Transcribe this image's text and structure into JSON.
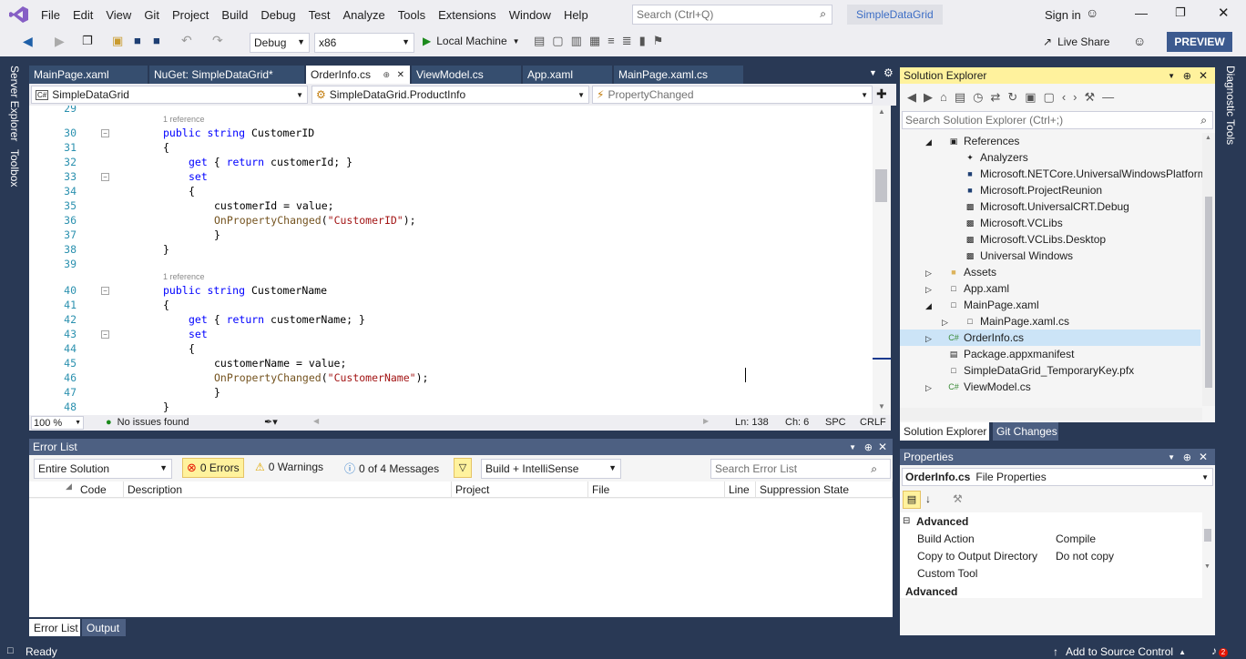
{
  "menu": {
    "items": [
      "File",
      "Edit",
      "View",
      "Git",
      "Project",
      "Build",
      "Debug",
      "Test",
      "Analyze",
      "Tools",
      "Extensions",
      "Window",
      "Help"
    ],
    "search_placeholder": "Search (Ctrl+Q)",
    "solution_name": "SimpleDataGrid",
    "sign_in": "Sign in"
  },
  "toolbar": {
    "config": "Debug",
    "platform": "x86",
    "run_label": "Local Machine",
    "live_share": "Live Share",
    "preview": "PREVIEW"
  },
  "side": {
    "left_tabs": [
      "Server Explorer",
      "Toolbox"
    ],
    "right_tabs": [
      "Diagnostic Tools"
    ]
  },
  "doc_tabs": [
    "MainPage.xaml",
    "NuGet: SimpleDataGrid*",
    "OrderInfo.cs",
    "ViewModel.cs",
    "App.xaml",
    "MainPage.xaml.cs"
  ],
  "nav": {
    "project": "SimpleDataGrid",
    "type": "SimpleDataGrid.ProductInfo",
    "member": "PropertyChanged"
  },
  "editor": {
    "lines": [
      "29",
      "30",
      "31",
      "32",
      "33",
      "34",
      "35",
      "36",
      "37",
      "38",
      "39",
      "40",
      "41",
      "42",
      "43",
      "44",
      "45",
      "46",
      "47",
      "48"
    ],
    "hint": "1 reference",
    "code": {
      "l30_kw": "public string ",
      "l30_id": "CustomerID",
      "l32_a": "get",
      "l32_b": " { ",
      "l32_c": "return",
      "l32_d": " customerId; }",
      "l33": "set",
      "l35": "customerId = value;",
      "l36_fn": "OnPropertyChanged",
      "l36_str": "\"CustomerID\"",
      "l40_kw": "public string ",
      "l40_id": "CustomerName",
      "l42_d": " customerName; }",
      "l45": "customerName = value;",
      "l46_str": "\"CustomerName\""
    }
  },
  "edit_status": {
    "zoom": "100 %",
    "issues": "No issues found",
    "ln": "Ln: 138",
    "ch": "Ch: 6",
    "spc": "SPC",
    "crlf": "CRLF"
  },
  "solution_explorer": {
    "title": "Solution Explorer",
    "search_placeholder": "Search Solution Explorer (Ctrl+;)",
    "items": [
      "References",
      "Analyzers",
      "Microsoft.NETCore.UniversalWindowsPlatform",
      "Microsoft.ProjectReunion",
      "Microsoft.UniversalCRT.Debug",
      "Microsoft.VCLibs",
      "Microsoft.VCLibs.Desktop",
      "Universal Windows",
      "Assets",
      "App.xaml",
      "MainPage.xaml",
      "MainPage.xaml.cs",
      "OrderInfo.cs",
      "Package.appxmanifest",
      "SimpleDataGrid_TemporaryKey.pfx",
      "ViewModel.cs"
    ],
    "tabs": [
      "Solution Explorer",
      "Git Changes"
    ]
  },
  "error_list": {
    "title": "Error List",
    "scope": "Entire Solution",
    "errors": "0 Errors",
    "warnings": "0 Warnings",
    "messages": "0 of 4 Messages",
    "build": "Build + IntelliSense",
    "search_placeholder": "Search Error List",
    "columns": [
      "Code",
      "Description",
      "Project",
      "File",
      "Line",
      "Suppression State"
    ],
    "tabs": [
      "Error List",
      "Output"
    ]
  },
  "properties": {
    "title": "Properties",
    "object": "OrderInfo.cs",
    "object_type": "File Properties",
    "category": "Advanced",
    "rows": [
      {
        "name": "Build Action",
        "value": "Compile"
      },
      {
        "name": "Copy to Output Directory",
        "value": "Do not copy"
      },
      {
        "name": "Custom Tool",
        "value": ""
      }
    ],
    "desc_title": "Advanced"
  },
  "status": {
    "ready": "Ready",
    "source_control": "Add to Source Control",
    "notifications": "2"
  },
  "colors": {
    "accent": "#293955",
    "highlight": "#fff29d",
    "preview": "#3c5a8f"
  }
}
